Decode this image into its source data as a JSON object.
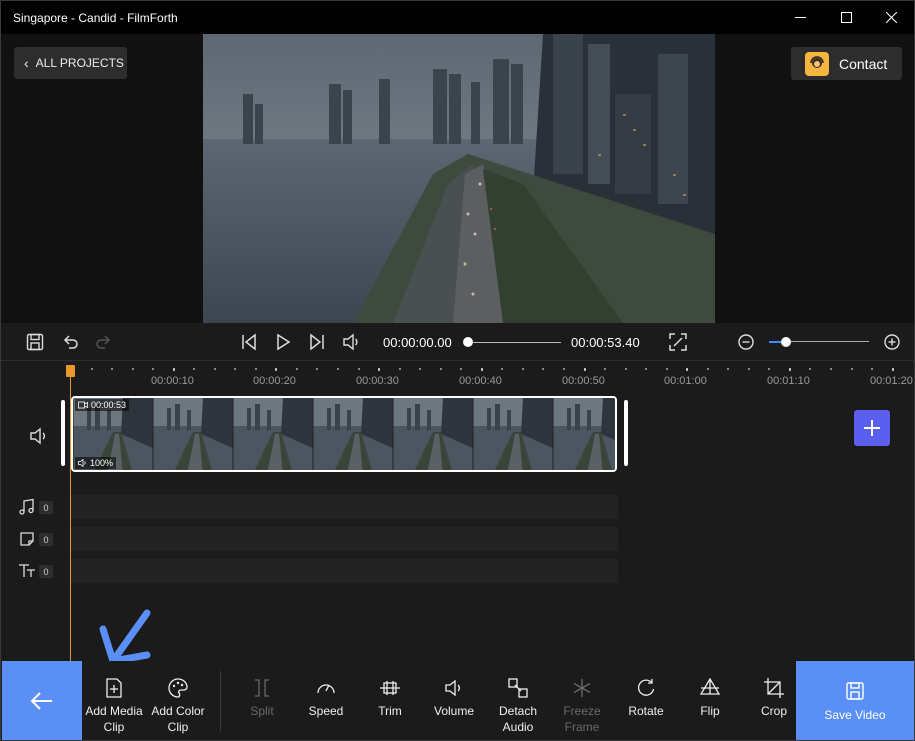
{
  "window": {
    "title": "Singapore - Candid - FilmForth"
  },
  "header": {
    "all_projects_label": "ALL PROJECTS",
    "contact_label": "Contact"
  },
  "player": {
    "current_time": "00:00:00.00",
    "total_time": "00:00:53.40",
    "scrub_progress": 0,
    "zoom_level": 0.17
  },
  "timeline": {
    "ruler_labels": [
      "00:00:10",
      "00:00:20",
      "00:00:30",
      "00:00:40",
      "00:00:50",
      "00:01:00",
      "00:01:10",
      "00:01:20"
    ],
    "clip": {
      "duration": "00:00:53",
      "volume": "100%"
    },
    "lanes": [
      {
        "name": "music",
        "count": "0"
      },
      {
        "name": "sticker",
        "count": "0"
      },
      {
        "name": "text",
        "count": "0"
      }
    ]
  },
  "toolbar": {
    "add_media_line1": "Add Media",
    "add_media_line2": "Clip",
    "add_color_line1": "Add Color",
    "add_color_line2": "Clip",
    "split": "Split",
    "speed": "Speed",
    "trim": "Trim",
    "volume": "Volume",
    "detach_line1": "Detach",
    "detach_line2": "Audio",
    "freeze_line1": "Freeze",
    "freeze_line2": "Frame",
    "rotate": "Rotate",
    "flip": "Flip",
    "crop": "Crop",
    "save_video": "Save Video"
  },
  "colors": {
    "accent": "#5a8ff5",
    "add_track": "#5a5ff0",
    "playhead": "#e9962c",
    "zoom_active": "#3b8cff"
  }
}
